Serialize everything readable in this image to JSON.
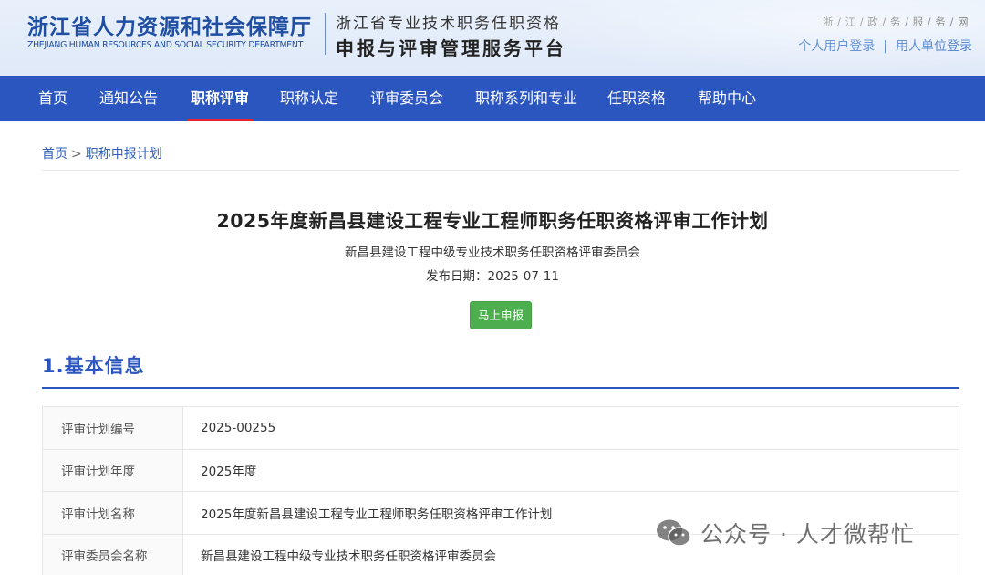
{
  "header": {
    "org_title": "浙江省人力资源和社会保障厅",
    "org_subtitle": "ZHEJIANG HUMAN RESOURCES AND SOCIAL SECURITY DEPARTMENT",
    "platform_line1": "浙江省专业技术职务任职资格",
    "platform_line2": "申报与评审管理服务平台",
    "gov_link": "浙 / 江 / 政 / 务 / 服 / 务 / 网",
    "personal_login": "个人用户登录",
    "separator": "|",
    "unit_login": "用人单位登录"
  },
  "nav": {
    "items": [
      {
        "label": "首页"
      },
      {
        "label": "通知公告"
      },
      {
        "label": "职称评审"
      },
      {
        "label": "职称认定"
      },
      {
        "label": "评审委员会"
      },
      {
        "label": "职称系列和专业"
      },
      {
        "label": "任职资格"
      },
      {
        "label": "帮助中心"
      }
    ],
    "active_index": 2
  },
  "breadcrumb": {
    "home": "首页",
    "arrow": ">",
    "current": "职称申报计划"
  },
  "article": {
    "title": "2025年度新昌县建设工程专业工程师职务任职资格评审工作计划",
    "committee": "新昌县建设工程中级专业技术职务任职资格评审委员会",
    "publish_date": "发布日期：2025-07-11",
    "apply_button": "马上申报"
  },
  "section": {
    "title": "1.基本信息"
  },
  "info_table": {
    "rows": [
      {
        "label": "评审计划编号",
        "value": "2025-00255"
      },
      {
        "label": "评审计划年度",
        "value": "2025年度"
      },
      {
        "label": "评审计划名称",
        "value": "2025年度新昌县建设工程专业工程师职务任职资格评审工作计划"
      },
      {
        "label": "评审委员会名称",
        "value": "新昌县建设工程中级专业技术职务任职资格评审委员会"
      }
    ]
  },
  "watermark": {
    "text": "公众号 · 人才微帮忙",
    "icon": "wechat-icon"
  },
  "colors": {
    "nav_bg": "#2c56bf",
    "nav_active_underline": "#e6262b",
    "brand_blue": "#1f4ea3",
    "button_green": "#4cae4c"
  }
}
